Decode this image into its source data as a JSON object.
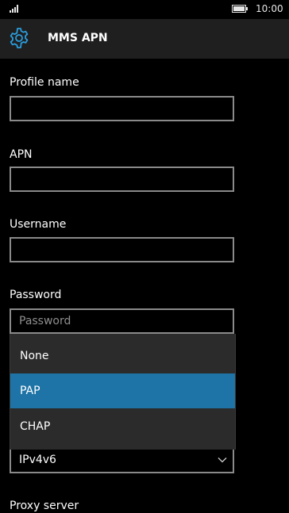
{
  "status_bar": {
    "time": "10:00",
    "signal_icon": "signal-bars-icon",
    "battery_icon": "battery-icon"
  },
  "header": {
    "title": "MMS APN",
    "icon": "settings-gear-icon",
    "accent_color": "#2a9ddd"
  },
  "form": {
    "profile_name": {
      "label": "Profile name",
      "value": ""
    },
    "apn": {
      "label": "APN",
      "value": ""
    },
    "username": {
      "label": "Username",
      "value": ""
    },
    "password": {
      "label": "Password",
      "value": "",
      "placeholder": "Password"
    },
    "auth_dropdown": {
      "options": [
        "None",
        "PAP",
        "CHAP"
      ],
      "highlighted": "PAP",
      "highlight_color": "#1e74a6"
    },
    "ip_type": {
      "value": "IPv4v6"
    },
    "proxy_server": {
      "label": "Proxy server"
    }
  }
}
